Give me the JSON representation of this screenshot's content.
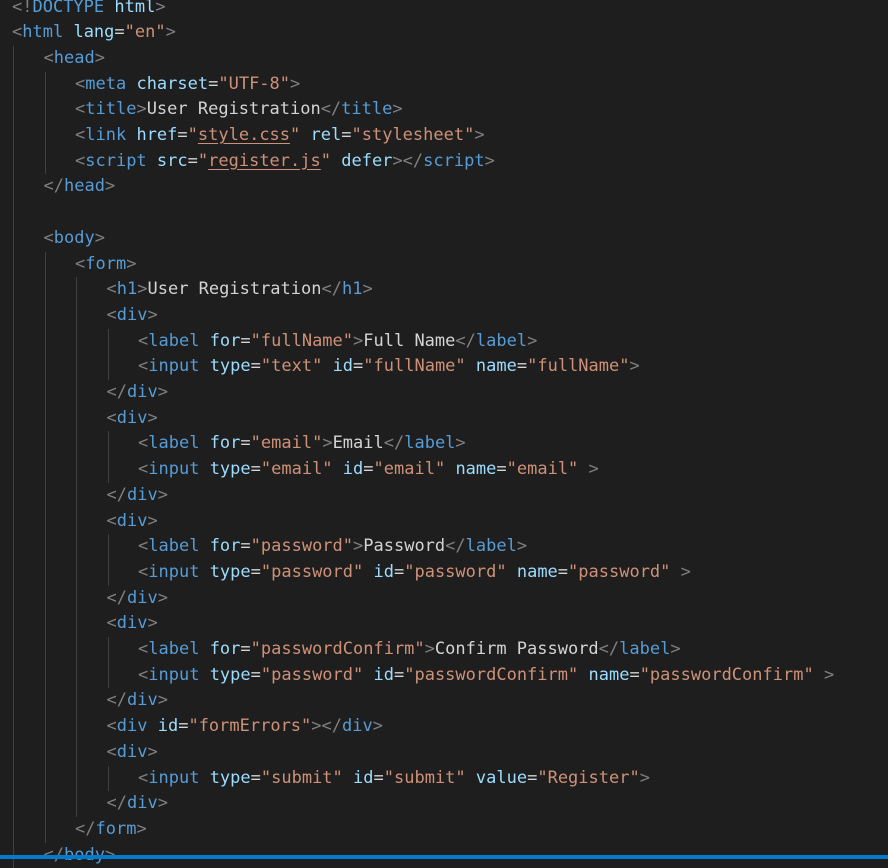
{
  "editor": {
    "language": "html",
    "colors": {
      "background": "#1e1e1e",
      "punctuation": "#808080",
      "tag": "#569cd6",
      "attribute": "#9cdcfe",
      "string": "#ce9178",
      "text": "#d4d4d4",
      "status_bar": "#007acc"
    },
    "lines": [
      {
        "indent": 0,
        "tokens": [
          [
            "<!",
            "punct"
          ],
          [
            "DOCTYPE",
            "doctype"
          ],
          [
            " ",
            "text"
          ],
          [
            "html",
            "dockey"
          ],
          [
            ">",
            "punct"
          ]
        ]
      },
      {
        "indent": 0,
        "tokens": [
          [
            "<",
            "punct"
          ],
          [
            "html",
            "tag"
          ],
          [
            " ",
            "text"
          ],
          [
            "lang",
            "attr"
          ],
          [
            "=",
            "text"
          ],
          [
            "\"en\"",
            "str"
          ],
          [
            ">",
            "punct"
          ]
        ]
      },
      {
        "indent": 1,
        "tokens": [
          [
            "<",
            "punct"
          ],
          [
            "head",
            "tag"
          ],
          [
            ">",
            "punct"
          ]
        ]
      },
      {
        "indent": 2,
        "tokens": [
          [
            "<",
            "punct"
          ],
          [
            "meta",
            "tag"
          ],
          [
            " ",
            "text"
          ],
          [
            "charset",
            "attr"
          ],
          [
            "=",
            "text"
          ],
          [
            "\"UTF-8\"",
            "str"
          ],
          [
            ">",
            "punct"
          ]
        ]
      },
      {
        "indent": 2,
        "tokens": [
          [
            "<",
            "punct"
          ],
          [
            "title",
            "tag"
          ],
          [
            ">",
            "punct"
          ],
          [
            "User Registration",
            "text"
          ],
          [
            "</",
            "punct"
          ],
          [
            "title",
            "tag"
          ],
          [
            ">",
            "punct"
          ]
        ]
      },
      {
        "indent": 2,
        "tokens": [
          [
            "<",
            "punct"
          ],
          [
            "link",
            "tag"
          ],
          [
            " ",
            "text"
          ],
          [
            "href",
            "attr"
          ],
          [
            "=",
            "text"
          ],
          [
            "\"",
            "str"
          ],
          [
            "style.css",
            "link"
          ],
          [
            "\"",
            "str"
          ],
          [
            " ",
            "text"
          ],
          [
            "rel",
            "attr"
          ],
          [
            "=",
            "text"
          ],
          [
            "\"stylesheet\"",
            "str"
          ],
          [
            ">",
            "punct"
          ]
        ]
      },
      {
        "indent": 2,
        "tokens": [
          [
            "<",
            "punct"
          ],
          [
            "script",
            "tag"
          ],
          [
            " ",
            "text"
          ],
          [
            "src",
            "attr"
          ],
          [
            "=",
            "text"
          ],
          [
            "\"",
            "str"
          ],
          [
            "register.js",
            "link"
          ],
          [
            "\"",
            "str"
          ],
          [
            " ",
            "text"
          ],
          [
            "defer",
            "attr"
          ],
          [
            "></",
            "punct"
          ],
          [
            "script",
            "tag"
          ],
          [
            ">",
            "punct"
          ]
        ]
      },
      {
        "indent": 1,
        "tokens": [
          [
            "</",
            "punct"
          ],
          [
            "head",
            "tag"
          ],
          [
            ">",
            "punct"
          ]
        ]
      },
      {
        "indent": 1,
        "tokens": []
      },
      {
        "indent": 1,
        "tokens": [
          [
            "<",
            "punct"
          ],
          [
            "body",
            "tag"
          ],
          [
            ">",
            "punct"
          ]
        ]
      },
      {
        "indent": 2,
        "tokens": [
          [
            "<",
            "punct"
          ],
          [
            "form",
            "tag"
          ],
          [
            ">",
            "punct"
          ]
        ]
      },
      {
        "indent": 3,
        "tokens": [
          [
            "<",
            "punct"
          ],
          [
            "h1",
            "tag"
          ],
          [
            ">",
            "punct"
          ],
          [
            "User Registration",
            "text"
          ],
          [
            "</",
            "punct"
          ],
          [
            "h1",
            "tag"
          ],
          [
            ">",
            "punct"
          ]
        ]
      },
      {
        "indent": 3,
        "tokens": [
          [
            "<",
            "punct"
          ],
          [
            "div",
            "tag"
          ],
          [
            ">",
            "punct"
          ]
        ]
      },
      {
        "indent": 4,
        "tokens": [
          [
            "<",
            "punct"
          ],
          [
            "label",
            "tag"
          ],
          [
            " ",
            "text"
          ],
          [
            "for",
            "attr"
          ],
          [
            "=",
            "text"
          ],
          [
            "\"fullName\"",
            "str"
          ],
          [
            ">",
            "punct"
          ],
          [
            "Full Name",
            "text"
          ],
          [
            "</",
            "punct"
          ],
          [
            "label",
            "tag"
          ],
          [
            ">",
            "punct"
          ]
        ]
      },
      {
        "indent": 4,
        "tokens": [
          [
            "<",
            "punct"
          ],
          [
            "input",
            "tag"
          ],
          [
            " ",
            "text"
          ],
          [
            "type",
            "attr"
          ],
          [
            "=",
            "text"
          ],
          [
            "\"text\"",
            "str"
          ],
          [
            " ",
            "text"
          ],
          [
            "id",
            "attr"
          ],
          [
            "=",
            "text"
          ],
          [
            "\"fullName\"",
            "str"
          ],
          [
            " ",
            "text"
          ],
          [
            "name",
            "attr"
          ],
          [
            "=",
            "text"
          ],
          [
            "\"fullName\"",
            "str"
          ],
          [
            ">",
            "punct"
          ]
        ]
      },
      {
        "indent": 3,
        "tokens": [
          [
            "</",
            "punct"
          ],
          [
            "div",
            "tag"
          ],
          [
            ">",
            "punct"
          ]
        ]
      },
      {
        "indent": 3,
        "tokens": [
          [
            "<",
            "punct"
          ],
          [
            "div",
            "tag"
          ],
          [
            ">",
            "punct"
          ]
        ]
      },
      {
        "indent": 4,
        "tokens": [
          [
            "<",
            "punct"
          ],
          [
            "label",
            "tag"
          ],
          [
            " ",
            "text"
          ],
          [
            "for",
            "attr"
          ],
          [
            "=",
            "text"
          ],
          [
            "\"email\"",
            "str"
          ],
          [
            ">",
            "punct"
          ],
          [
            "Email",
            "text"
          ],
          [
            "</",
            "punct"
          ],
          [
            "label",
            "tag"
          ],
          [
            ">",
            "punct"
          ]
        ]
      },
      {
        "indent": 4,
        "tokens": [
          [
            "<",
            "punct"
          ],
          [
            "input",
            "tag"
          ],
          [
            " ",
            "text"
          ],
          [
            "type",
            "attr"
          ],
          [
            "=",
            "text"
          ],
          [
            "\"email\"",
            "str"
          ],
          [
            " ",
            "text"
          ],
          [
            "id",
            "attr"
          ],
          [
            "=",
            "text"
          ],
          [
            "\"email\"",
            "str"
          ],
          [
            " ",
            "text"
          ],
          [
            "name",
            "attr"
          ],
          [
            "=",
            "text"
          ],
          [
            "\"email\"",
            "str"
          ],
          [
            " ",
            "text"
          ],
          [
            ">",
            "punct"
          ]
        ]
      },
      {
        "indent": 3,
        "tokens": [
          [
            "</",
            "punct"
          ],
          [
            "div",
            "tag"
          ],
          [
            ">",
            "punct"
          ]
        ]
      },
      {
        "indent": 3,
        "tokens": [
          [
            "<",
            "punct"
          ],
          [
            "div",
            "tag"
          ],
          [
            ">",
            "punct"
          ]
        ]
      },
      {
        "indent": 4,
        "tokens": [
          [
            "<",
            "punct"
          ],
          [
            "label",
            "tag"
          ],
          [
            " ",
            "text"
          ],
          [
            "for",
            "attr"
          ],
          [
            "=",
            "text"
          ],
          [
            "\"password\"",
            "str"
          ],
          [
            ">",
            "punct"
          ],
          [
            "Password",
            "text"
          ],
          [
            "</",
            "punct"
          ],
          [
            "label",
            "tag"
          ],
          [
            ">",
            "punct"
          ]
        ]
      },
      {
        "indent": 4,
        "tokens": [
          [
            "<",
            "punct"
          ],
          [
            "input",
            "tag"
          ],
          [
            " ",
            "text"
          ],
          [
            "type",
            "attr"
          ],
          [
            "=",
            "text"
          ],
          [
            "\"password\"",
            "str"
          ],
          [
            " ",
            "text"
          ],
          [
            "id",
            "attr"
          ],
          [
            "=",
            "text"
          ],
          [
            "\"password\"",
            "str"
          ],
          [
            " ",
            "text"
          ],
          [
            "name",
            "attr"
          ],
          [
            "=",
            "text"
          ],
          [
            "\"password\"",
            "str"
          ],
          [
            " ",
            "text"
          ],
          [
            ">",
            "punct"
          ]
        ]
      },
      {
        "indent": 3,
        "tokens": [
          [
            "</",
            "punct"
          ],
          [
            "div",
            "tag"
          ],
          [
            ">",
            "punct"
          ]
        ]
      },
      {
        "indent": 3,
        "tokens": [
          [
            "<",
            "punct"
          ],
          [
            "div",
            "tag"
          ],
          [
            ">",
            "punct"
          ]
        ]
      },
      {
        "indent": 4,
        "tokens": [
          [
            "<",
            "punct"
          ],
          [
            "label",
            "tag"
          ],
          [
            " ",
            "text"
          ],
          [
            "for",
            "attr"
          ],
          [
            "=",
            "text"
          ],
          [
            "\"passwordConfirm\"",
            "str"
          ],
          [
            ">",
            "punct"
          ],
          [
            "Confirm Password",
            "text"
          ],
          [
            "</",
            "punct"
          ],
          [
            "label",
            "tag"
          ],
          [
            ">",
            "punct"
          ]
        ]
      },
      {
        "indent": 4,
        "tokens": [
          [
            "<",
            "punct"
          ],
          [
            "input",
            "tag"
          ],
          [
            " ",
            "text"
          ],
          [
            "type",
            "attr"
          ],
          [
            "=",
            "text"
          ],
          [
            "\"password\"",
            "str"
          ],
          [
            " ",
            "text"
          ],
          [
            "id",
            "attr"
          ],
          [
            "=",
            "text"
          ],
          [
            "\"passwordConfirm\"",
            "str"
          ],
          [
            " ",
            "text"
          ],
          [
            "name",
            "attr"
          ],
          [
            "=",
            "text"
          ],
          [
            "\"passwordConfirm\"",
            "str"
          ],
          [
            " ",
            "text"
          ],
          [
            ">",
            "punct"
          ]
        ]
      },
      {
        "indent": 3,
        "tokens": [
          [
            "</",
            "punct"
          ],
          [
            "div",
            "tag"
          ],
          [
            ">",
            "punct"
          ]
        ]
      },
      {
        "indent": 3,
        "tokens": [
          [
            "<",
            "punct"
          ],
          [
            "div",
            "tag"
          ],
          [
            " ",
            "text"
          ],
          [
            "id",
            "attr"
          ],
          [
            "=",
            "text"
          ],
          [
            "\"formErrors\"",
            "str"
          ],
          [
            "></",
            "punct"
          ],
          [
            "div",
            "tag"
          ],
          [
            ">",
            "punct"
          ]
        ]
      },
      {
        "indent": 3,
        "tokens": [
          [
            "<",
            "punct"
          ],
          [
            "div",
            "tag"
          ],
          [
            ">",
            "punct"
          ]
        ]
      },
      {
        "indent": 4,
        "tokens": [
          [
            "<",
            "punct"
          ],
          [
            "input",
            "tag"
          ],
          [
            " ",
            "text"
          ],
          [
            "type",
            "attr"
          ],
          [
            "=",
            "text"
          ],
          [
            "\"submit\"",
            "str"
          ],
          [
            " ",
            "text"
          ],
          [
            "id",
            "attr"
          ],
          [
            "=",
            "text"
          ],
          [
            "\"submit\"",
            "str"
          ],
          [
            " ",
            "text"
          ],
          [
            "value",
            "attr"
          ],
          [
            "=",
            "text"
          ],
          [
            "\"Register\"",
            "str"
          ],
          [
            ">",
            "punct"
          ]
        ]
      },
      {
        "indent": 3,
        "tokens": [
          [
            "</",
            "punct"
          ],
          [
            "div",
            "tag"
          ],
          [
            ">",
            "punct"
          ]
        ]
      },
      {
        "indent": 2,
        "tokens": [
          [
            "</",
            "punct"
          ],
          [
            "form",
            "tag"
          ],
          [
            ">",
            "punct"
          ]
        ]
      },
      {
        "indent": 1,
        "tokens": [
          [
            "</",
            "punct"
          ],
          [
            "body",
            "tag"
          ],
          [
            ">",
            "punct"
          ]
        ]
      }
    ]
  }
}
